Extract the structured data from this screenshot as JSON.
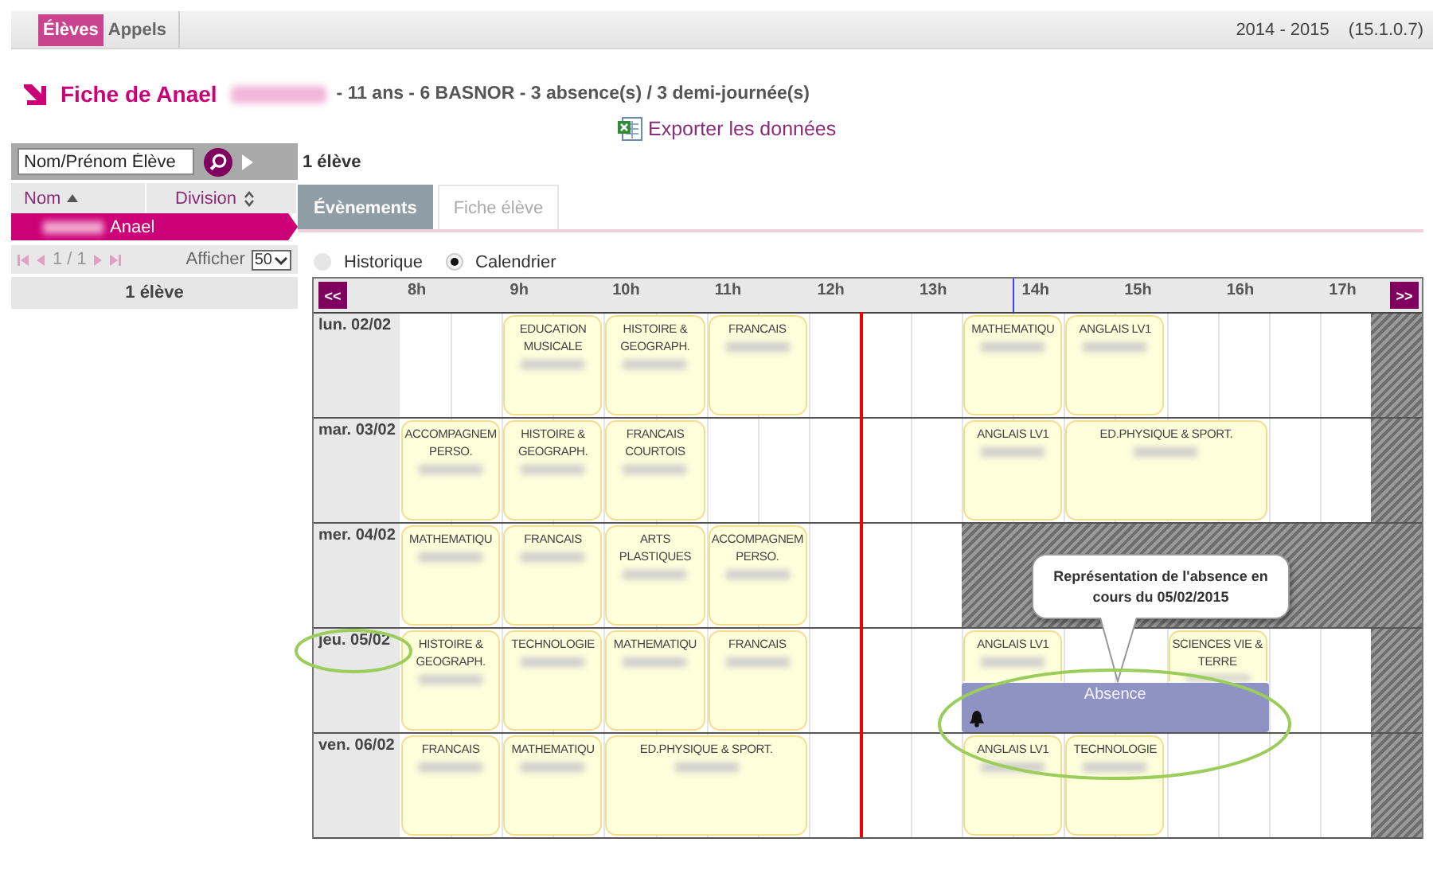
{
  "top_bar": {
    "tabs": [
      {
        "label": "Élèves",
        "selected": true
      },
      {
        "label": "Appels",
        "selected": false
      }
    ],
    "year": "2014 - 2015",
    "version": "(15.1.0.7)"
  },
  "header": {
    "title": "Fiche de Anael",
    "details": "- 11 ans - 6 BASNOR - 3 absence(s) / 3 demi-journée(s)",
    "export_link": "Exporter les données"
  },
  "student_list": {
    "search": {
      "placeholder": "Nom/Prénom Élève"
    },
    "columns": [
      {
        "label": "Nom",
        "sorted": true
      },
      {
        "label": "Division",
        "sorted": false
      }
    ],
    "rows": [
      {
        "name": "Anael",
        "selected": true
      }
    ],
    "pager": {
      "page": "1 / 1",
      "show_label": "Afficher",
      "page_size": "50"
    },
    "count": "1 élève"
  },
  "main": {
    "count": "1 élève",
    "tabs": [
      {
        "label": "Évènements",
        "selected": true
      },
      {
        "label": "Fiche élève",
        "selected": false
      }
    ],
    "view_options": [
      {
        "label": "Historique",
        "selected": false
      },
      {
        "label": "Calendrier",
        "selected": true
      }
    ],
    "calendar": {
      "prev": "<<",
      "next": ">>",
      "hours": [
        "8h",
        "9h",
        "10h",
        "11h",
        "12h",
        "13h",
        "14h",
        "15h",
        "16h",
        "17h"
      ],
      "days": [
        {
          "label": "lun. 02/02",
          "slots": [
            {
              "kind": "gap"
            },
            {
              "kind": "gap"
            },
            {
              "kind": "lesson",
              "subject": "EDUCATION MUSICALE",
              "long": false
            },
            {
              "kind": "lesson",
              "subject": "HISTOIRE & GEOGRAPH.",
              "long": false
            },
            {
              "kind": "lesson",
              "subject": "FRANCAIS",
              "long": false
            },
            {
              "kind": "gap"
            },
            {
              "kind": "gap"
            },
            {
              "kind": "gap"
            },
            {
              "kind": "lesson",
              "subject": "MATHEMATIQU",
              "long": false
            },
            {
              "kind": "lesson",
              "subject": "ANGLAIS LV1",
              "long": false
            }
          ]
        },
        {
          "label": "mar. 03/02",
          "slots": [
            {
              "kind": "lesson",
              "subject": "ACCOMPAGNEM PERSO.",
              "long": false
            },
            {
              "kind": "lesson",
              "subject": "HISTOIRE & GEOGRAPH.",
              "long": false
            },
            {
              "kind": "lesson",
              "subject": "FRANCAIS COURTOIS",
              "long": false
            },
            {
              "kind": "gap"
            },
            {
              "kind": "gap"
            },
            {
              "kind": "gap"
            },
            {
              "kind": "gap"
            },
            {
              "kind": "gap"
            },
            {
              "kind": "lesson",
              "subject": "ANGLAIS LV1",
              "long": false
            },
            {
              "kind": "lesson",
              "subject": "ED.PHYSIQUE & SPORT.",
              "long": true
            }
          ]
        },
        {
          "label": "mer. 04/02",
          "slots": [
            {
              "kind": "lesson",
              "subject": "MATHEMATIQU",
              "long": false
            },
            {
              "kind": "lesson",
              "subject": "FRANCAIS",
              "long": false
            },
            {
              "kind": "lesson",
              "subject": "ARTS PLASTIQUES",
              "long": false
            },
            {
              "kind": "lesson",
              "subject": "ACCOMPAGNEM PERSO.",
              "long": false
            },
            {
              "kind": "gap"
            },
            {
              "kind": "gap"
            },
            {
              "kind": "gap"
            },
            {
              "kind": "blocked"
            }
          ]
        },
        {
          "label": "jeu. 05/02",
          "slots": [
            {
              "kind": "lesson",
              "subject": "HISTOIRE & GEOGRAPH.",
              "long": false
            },
            {
              "kind": "lesson",
              "subject": "TECHNOLOGIE",
              "long": false
            },
            {
              "kind": "lesson",
              "subject": "MATHEMATIQU",
              "long": false
            },
            {
              "kind": "lesson",
              "subject": "FRANCAIS",
              "long": false
            },
            {
              "kind": "gap"
            },
            {
              "kind": "gap"
            },
            {
              "kind": "gap"
            },
            {
              "kind": "lesson",
              "subject": "ANGLAIS LV1",
              "long": false,
              "absence": {
                "label": "Absence"
              }
            },
            {
              "kind": "gap"
            },
            {
              "kind": "gap"
            },
            {
              "kind": "lesson",
              "subject": "SCIENCES VIE & TERRE",
              "long": false
            }
          ]
        },
        {
          "label": "ven. 06/02",
          "slots": [
            {
              "kind": "lesson",
              "subject": "FRANCAIS",
              "long": false
            },
            {
              "kind": "lesson",
              "subject": "MATHEMATIQU",
              "long": false
            },
            {
              "kind": "lesson",
              "subject": "ED.PHYSIQUE & SPORT.",
              "long": true
            },
            {
              "kind": "gap"
            },
            {
              "kind": "gap"
            },
            {
              "kind": "gap"
            },
            {
              "kind": "lesson",
              "subject": "ANGLAIS LV1",
              "long": false
            },
            {
              "kind": "lesson",
              "subject": "TECHNOLOGIE",
              "long": false
            }
          ]
        }
      ]
    }
  },
  "annotations": [
    {
      "kind": "callout",
      "text": "Représentation de l'absence en cours du 05/02/2015"
    },
    {
      "kind": "ellipse"
    },
    {
      "kind": "ellipse"
    }
  ]
}
